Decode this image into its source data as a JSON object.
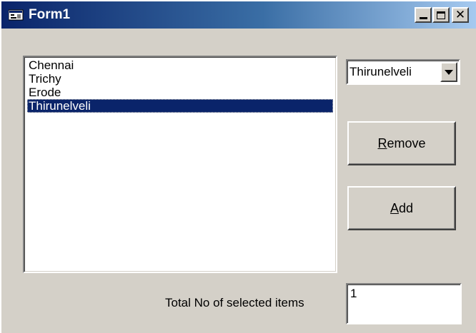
{
  "window": {
    "title": "Form1",
    "icon": "form-icon",
    "controls": {
      "minimize_icon": "minimize-icon",
      "maximize_icon": "maximize-icon",
      "close_glyph": "✕"
    }
  },
  "listbox": {
    "items": [
      {
        "label": "Chennai",
        "selected": false
      },
      {
        "label": "Trichy",
        "selected": false
      },
      {
        "label": "Erode",
        "selected": false
      },
      {
        "label": "Thirunelveli",
        "selected": true
      }
    ]
  },
  "combo": {
    "value": "Thirunelveli",
    "dropdown_icon": "chevron-down-icon"
  },
  "buttons": {
    "remove": {
      "accel": "R",
      "rest": "emove"
    },
    "add": {
      "accel": "A",
      "rest": "dd"
    }
  },
  "status": {
    "label": "Total No of selected items",
    "value": "1"
  },
  "colors": {
    "titlebar_start": "#0a246a",
    "titlebar_end": "#a6caf0",
    "face": "#d4d0c8",
    "selection": "#0a246a"
  }
}
